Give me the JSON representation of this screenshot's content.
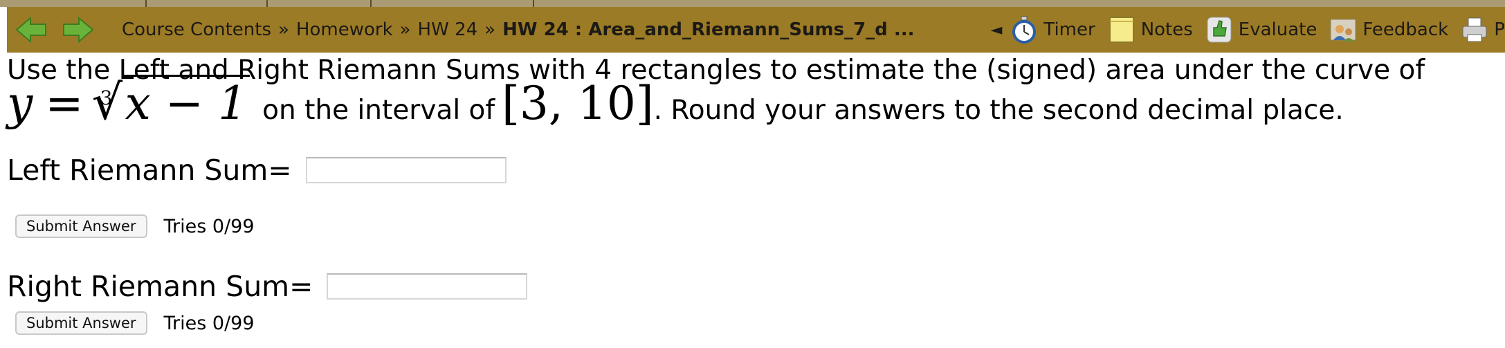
{
  "navbar": {
    "breadcrumbs": [
      "Course Contents",
      "Homework",
      "HW 24"
    ],
    "breadcrumb_separator": "»",
    "current_problem": "HW 24 : Area_and_Riemann_Sums_7_d ...",
    "collapse_glyph": "◄",
    "tools": [
      {
        "label": "Timer",
        "icon": "stopwatch-icon"
      },
      {
        "label": "Notes",
        "icon": "notes-icon"
      },
      {
        "label": "Evaluate",
        "icon": "evaluate-icon"
      },
      {
        "label": "Feedback",
        "icon": "feedback-icon"
      },
      {
        "label": "Print",
        "icon": "printer-icon"
      }
    ],
    "colors": {
      "bar": "#9c7b27",
      "arrow_green": "#69b33a"
    }
  },
  "problem": {
    "line1": "Use the Left and Right Riemann Sums with 4 rectangles to estimate the (signed) area under the curve of",
    "eq_lhs": "y",
    "eq_sign": "=",
    "root_index": "3",
    "radicand": "x − 1",
    "text_mid": "on the interval of",
    "interval": "[3, 10]",
    "text_end": ". Round your answers to the second decimal place."
  },
  "answers": [
    {
      "label": "Left Riemann Sum=",
      "value": "",
      "submit_label": "Submit Answer",
      "tries": "Tries 0/99"
    },
    {
      "label": "Right Riemann Sum=",
      "value": "",
      "submit_label": "Submit Answer",
      "tries": "Tries 0/99"
    }
  ]
}
